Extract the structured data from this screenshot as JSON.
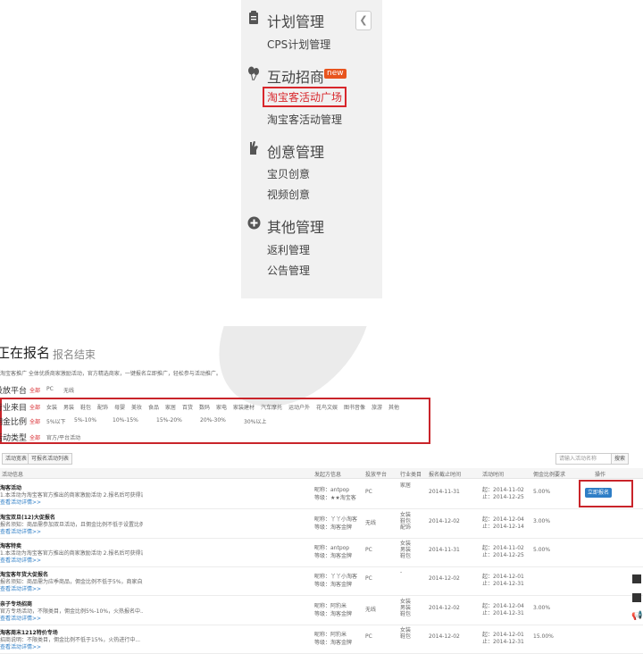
{
  "sidebar": {
    "sections": [
      {
        "title": "计划管理",
        "icon": "clipboard-icon",
        "items": [
          "CPS计划管理"
        ]
      },
      {
        "title": "互动招商",
        "icon": "balloon-icon",
        "badge": "new",
        "items": [
          "淘宝客活动广场",
          "淘宝客活动管理"
        ]
      },
      {
        "title": "创意管理",
        "icon": "hand-icon",
        "items": [
          "宝贝创意",
          "视频创意"
        ]
      },
      {
        "title": "其他管理",
        "icon": "plus-circle-icon",
        "items": [
          "返利管理",
          "公告管理"
        ]
      }
    ],
    "collapse_icon": "chevron-left-icon"
  },
  "panel": {
    "title": "正在报名",
    "title2": "报名结束",
    "desc": "淘宝客推广 全体优质商家激励活动，官方精选商家，一键报名立即推广，轻松参与活动推广。",
    "filters": {
      "platform_label": "投放平台",
      "platform_options": [
        "全部",
        "PC",
        "无线"
      ],
      "source_label": "行业来目",
      "source_options": [
        "全部",
        "女装",
        "男装",
        "鞋包",
        "配饰",
        "母婴",
        "美妆",
        "食品",
        "家居",
        "百货",
        "数码",
        "家电",
        "家装建材",
        "汽车摩托",
        "运动户外",
        "花鸟文娱",
        "图书音像",
        "旅游",
        "其他"
      ],
      "ratio_label": "佣金比例",
      "ratio_options": [
        "全部",
        "5%以下",
        "5%-10%",
        "10%-15%",
        "15%-20%",
        "20%-30%",
        "30%以上"
      ],
      "type_label": "活动类型",
      "type_options": [
        "全部",
        "官方/平台活动"
      ]
    },
    "tabs": [
      "活动宽表",
      "可报名活动列表"
    ],
    "search_placeholder": "请输入活动名称",
    "search_button": "搜索",
    "columns": [
      "活动信息",
      "发起方信息",
      "投放平台",
      "行业类目",
      "报名截止时间",
      "活动时间",
      "佣金比例要求",
      "操作"
    ],
    "rows": [
      {
        "name": "淘客活动",
        "desc": "1.本活动为淘宝客官方推出的商家激励活动 2.报名后可获得流量曝光...",
        "link": "查看活动详情>>",
        "sponsor_nick": "昵称：antpop",
        "sponsor_level": "等级：★★淘宝客",
        "platform": "PC",
        "category": "家居",
        "deadline": "2014-11-31",
        "start": "起：2014-11-02",
        "end": "止：2014-12-25",
        "ratio": "5.00%",
        "action": "立即报名"
      },
      {
        "name": "淘宝双旦(12)大促报名",
        "desc": "报名须知：商品需参加双旦活动，且佣金比例不低于设置比例...",
        "link": "查看活动详情>>",
        "sponsor_nick": "昵称：丫丫小淘客",
        "sponsor_level": "等级：淘客金牌",
        "platform": "无线",
        "category": "女装\n鞋包\n配饰",
        "deadline": "2014-12-02",
        "start": "起：2014-12-04",
        "end": "止：2014-12-14",
        "ratio": "3.00%",
        "action": ""
      },
      {
        "name": "淘客特卖",
        "desc": "1.本活动为淘宝客官方推出的商家激励活动 2.报名后可获得流量曝光...",
        "link": "查看活动详情>>",
        "sponsor_nick": "昵称：antpop",
        "sponsor_level": "等级：淘客金牌",
        "platform": "PC",
        "category": "女装\n男装\n鞋包",
        "deadline": "2014-11-31",
        "start": "起：2014-11-02",
        "end": "止：2014-12-25",
        "ratio": "5.00%",
        "action": ""
      },
      {
        "name": "淘宝客年货大促报名",
        "desc": "报名须知：商品需为应季商品，佣金比例不低于5%，商家自主报名...",
        "link": "查看活动详情>>",
        "sponsor_nick": "昵称：丫丫小淘客",
        "sponsor_level": "等级：淘客金牌",
        "platform": "PC",
        "category": "-",
        "deadline": "2014-12-02",
        "start": "起：2014-12-01",
        "end": "止：2014-12-31",
        "ratio": "",
        "action": ""
      },
      {
        "name": "亲子专场招商",
        "desc": "官方专场活动，不限类目，佣金比例5%-10%，火热报名中...",
        "link": "查看活动详情>>",
        "sponsor_nick": "昵称：阿豹米",
        "sponsor_level": "等级：淘客金牌",
        "platform": "无线",
        "category": "女装\n男装\n鞋包",
        "deadline": "2014-12-02",
        "start": "起：2014-12-04",
        "end": "止：2014-12-31",
        "ratio": "3.00%",
        "action": ""
      },
      {
        "name": "淘客周末1212特价专场",
        "desc": "招商说明：不限类目，佣金比例不低于15%，火热进行中...",
        "link": "查看活动详情>>",
        "sponsor_nick": "昵称：阿豹米",
        "sponsor_level": "等级：淘客金牌",
        "platform": "PC",
        "category": "女装\n鞋包",
        "deadline": "2014-12-02",
        "start": "起：2014-12-01",
        "end": "止：2014-12-31",
        "ratio": "15.00%",
        "action": ""
      }
    ]
  },
  "right_icons": [
    "qr-code-icon",
    "qr-code-icon",
    "speaker-icon"
  ],
  "colors": {
    "accent_red": "#d8262b",
    "new_badge": "#e8541e",
    "button_blue": "#2e7ec6"
  }
}
